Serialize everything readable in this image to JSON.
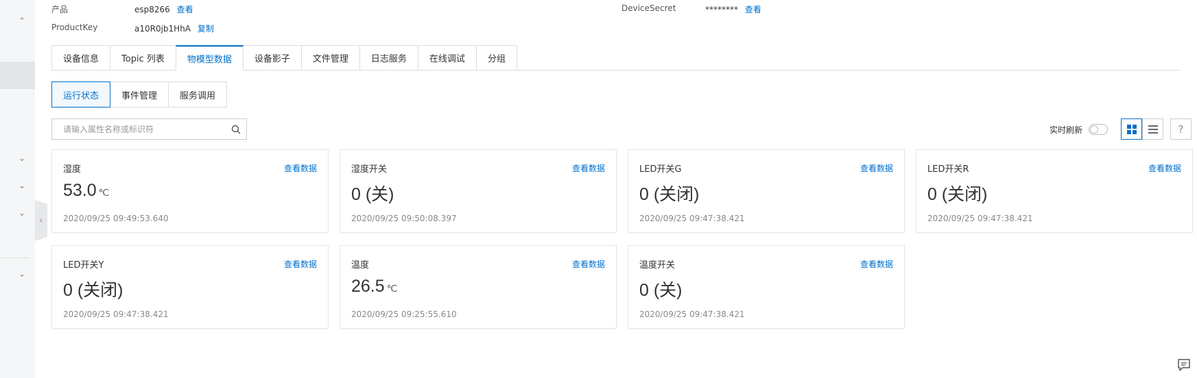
{
  "header": {
    "product_label": "产品",
    "product_value": "esp8266",
    "product_link": "查看",
    "productkey_label": "ProductKey",
    "productkey_value": "a10R0jb1HhA",
    "productkey_link": "复制",
    "secret_label": "DeviceSecret",
    "secret_value": "********",
    "secret_link": "查看"
  },
  "tabs": [
    {
      "label": "设备信息"
    },
    {
      "label": "Topic 列表"
    },
    {
      "label": "物模型数据"
    },
    {
      "label": "设备影子"
    },
    {
      "label": "文件管理"
    },
    {
      "label": "日志服务"
    },
    {
      "label": "在线调试"
    },
    {
      "label": "分组"
    }
  ],
  "subtabs": [
    {
      "label": "运行状态"
    },
    {
      "label": "事件管理"
    },
    {
      "label": "服务调用"
    }
  ],
  "search": {
    "placeholder": "请输入属性名称或标识符"
  },
  "toolbar": {
    "realtime_label": "实时刷新",
    "help": "?"
  },
  "cards": [
    {
      "name": "湿度",
      "link": "查看数据",
      "value": "53.0",
      "unit": "℃",
      "time": "2020/09/25 09:49:53.640"
    },
    {
      "name": "湿度开关",
      "link": "查看数据",
      "value": "0 (关)",
      "unit": "",
      "time": "2020/09/25 09:50:08.397"
    },
    {
      "name": "LED开关G",
      "link": "查看数据",
      "value": "0 (关闭)",
      "unit": "",
      "time": "2020/09/25 09:47:38.421"
    },
    {
      "name": "LED开关R",
      "link": "查看数据",
      "value": "0 (关闭)",
      "unit": "",
      "time": "2020/09/25 09:47:38.421"
    },
    {
      "name": "LED开关Y",
      "link": "查看数据",
      "value": "0 (关闭)",
      "unit": "",
      "time": "2020/09/25 09:47:38.421"
    },
    {
      "name": "温度",
      "link": "查看数据",
      "value": "26.5",
      "unit": "℃",
      "time": "2020/09/25 09:25:55.610"
    },
    {
      "name": "温度开关",
      "link": "查看数据",
      "value": "0 (关)",
      "unit": "",
      "time": "2020/09/25 09:47:38.421"
    }
  ],
  "colors": {
    "accent": "#0070cc",
    "border": "#dcdcdc",
    "sidebar": "#f5f6f7"
  },
  "icons": [
    "chevron-up-icon",
    "chevron-down-icon",
    "chevron-left-icon",
    "search-icon",
    "grid-view-icon",
    "list-view-icon",
    "help-icon",
    "chat-icon"
  ]
}
